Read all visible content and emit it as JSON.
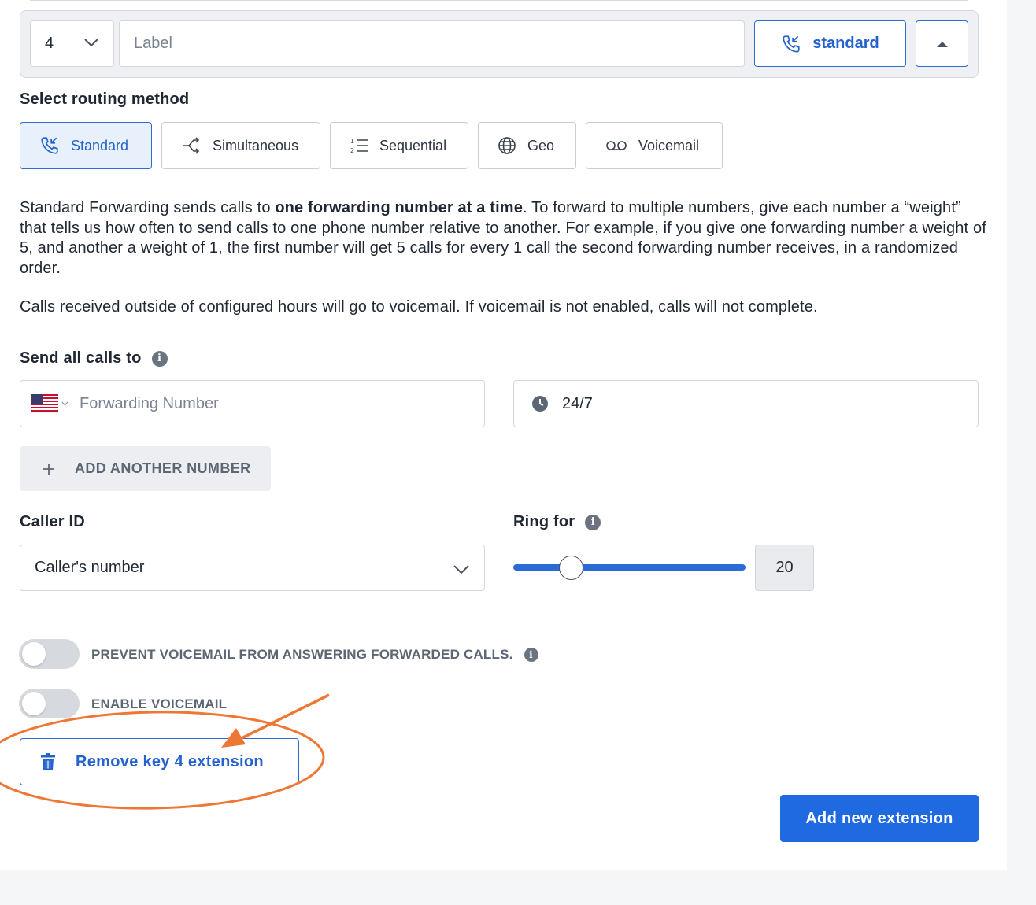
{
  "extension": {
    "key": "4",
    "label_placeholder": "Label",
    "mode_label": "standard",
    "collapse_icon": "caret-up-icon"
  },
  "routing": {
    "title": "Select routing method",
    "methods": [
      {
        "label": "Standard",
        "icon": "phone-forward-icon",
        "active": true
      },
      {
        "label": "Simultaneous",
        "icon": "split-arrows-icon",
        "active": false
      },
      {
        "label": "Sequential",
        "icon": "numbered-list-icon",
        "active": false
      },
      {
        "label": "Geo",
        "icon": "globe-icon",
        "active": false
      },
      {
        "label": "Voicemail",
        "icon": "voicemail-icon",
        "active": false
      }
    ]
  },
  "description": {
    "p1_a": "Standard Forwarding sends calls to ",
    "p1_bold": "one forwarding number at a time",
    "p1_b": ". To forward to multiple numbers, give each number a “weight” that tells us how often to send calls to one phone number relative to another. For example, if you give one forwarding number a weight of 5, and another a weight of 1, the first number will get 5 calls for every 1 call the second forwarding number receives, in a randomized order.",
    "p2": "Calls received outside of configured hours will go to voicemail. If voicemail is not enabled, calls will not complete."
  },
  "send_calls": {
    "title": "Send all calls to",
    "number_placeholder": "Forwarding Number",
    "schedule": "24/7",
    "add_number_label": "ADD ANOTHER NUMBER"
  },
  "caller_id": {
    "title": "Caller ID",
    "value": "Caller's number"
  },
  "ring_for": {
    "title": "Ring for",
    "value": "20",
    "slider_fraction": 0.25
  },
  "toggles": {
    "prevent_voicemail": {
      "label": "PREVENT VOICEMAIL FROM ANSWERING FORWARDED CALLS.",
      "on": false
    },
    "enable_voicemail": {
      "label": "ENABLE VOICEMAIL",
      "on": false
    }
  },
  "actions": {
    "remove_label": "Remove key 4 extension",
    "add_label": "Add new extension"
  },
  "colors": {
    "accent": "#2463cf",
    "annotation": "#ee7733"
  }
}
